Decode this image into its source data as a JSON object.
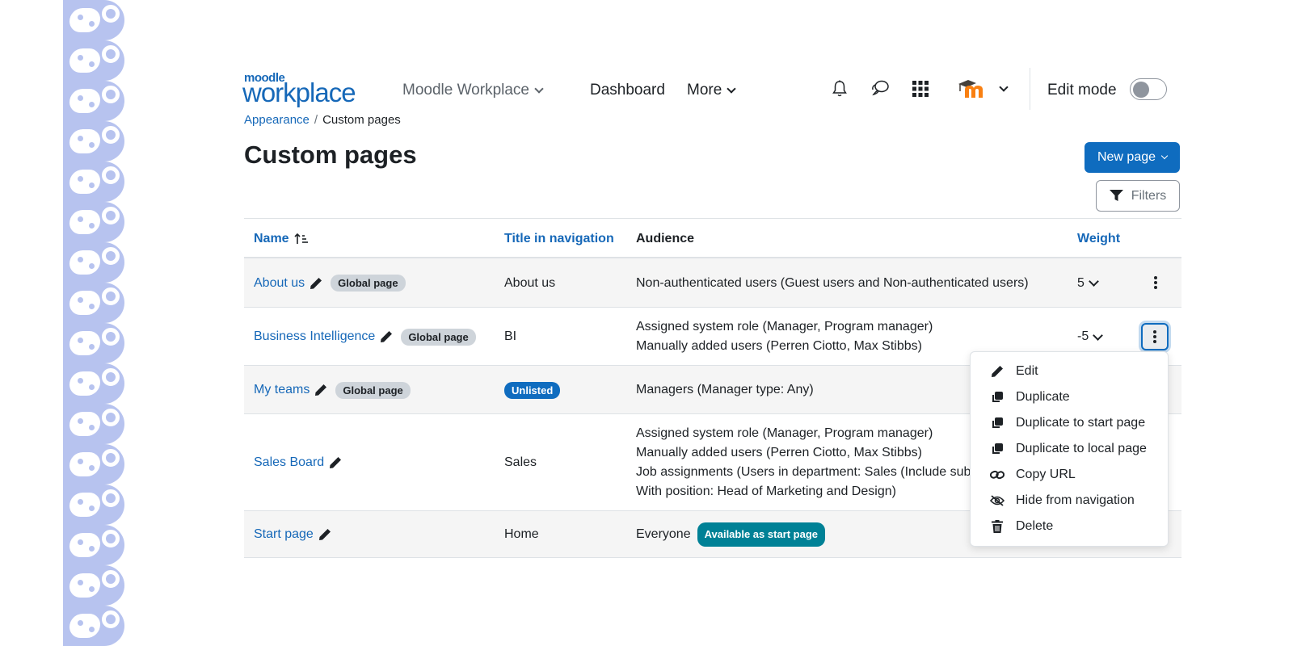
{
  "header": {
    "logo_small": "moodle",
    "logo_big": "workplace",
    "site_menu": "Moodle Workplace",
    "nav_dashboard": "Dashboard",
    "nav_more": "More",
    "edit_mode_label": "Edit mode",
    "edit_mode_on": false
  },
  "breadcrumb": {
    "parent": "Appearance",
    "separator": "/",
    "current": "Custom pages"
  },
  "page": {
    "title": "Custom pages",
    "new_page_label": "New page",
    "filters_label": "Filters"
  },
  "table": {
    "headers": {
      "name": "Name",
      "title_nav": "Title in navigation",
      "audience": "Audience",
      "weight": "Weight"
    },
    "rows": [
      {
        "name": "About us",
        "badge": "Global page",
        "title_nav": "About us",
        "audience": [
          "Non-authenticated users (Guest users and Non-authenticated users)"
        ],
        "weight": "5"
      },
      {
        "name": "Business Intelligence",
        "badge": "Global page",
        "title_nav": "BI",
        "audience": [
          "Assigned system role (Manager, Program manager)",
          "Manually added users (Perren Ciotto, Max Stibbs)"
        ],
        "weight": "-5"
      },
      {
        "name": "My teams",
        "badge": "Global page",
        "title_nav_badge": "Unlisted",
        "audience": [
          "Managers (Manager type: Any)"
        ]
      },
      {
        "name": "Sales Board",
        "title_nav": "Sales",
        "audience": [
          "Assigned system role (Manager, Program manager)",
          "Manually added users (Perren Ciotto, Max Stibbs)",
          "Job assignments (Users in department: Sales (Include sub",
          "With position: Head of Marketing and Design)"
        ]
      },
      {
        "name": "Start page",
        "title_nav": "Home",
        "audience": [
          "Everyone"
        ],
        "audience_badge": "Available as start page"
      }
    ]
  },
  "menu": {
    "items": [
      {
        "label": "Edit",
        "icon": "pencil-icon"
      },
      {
        "label": "Duplicate",
        "icon": "copy-icon"
      },
      {
        "label": "Duplicate to start page",
        "icon": "copy-icon"
      },
      {
        "label": "Duplicate to local page",
        "icon": "copy-icon"
      },
      {
        "label": "Copy URL",
        "icon": "link-icon"
      },
      {
        "label": "Hide from navigation",
        "icon": "eye-slash-icon"
      },
      {
        "label": "Delete",
        "icon": "trash-icon"
      }
    ]
  },
  "colors": {
    "primary": "#0f6cbf",
    "link": "#1668b8",
    "teal_badge": "#008196",
    "grey_badge": "#ced4da",
    "decor": "#b7c3ef"
  }
}
